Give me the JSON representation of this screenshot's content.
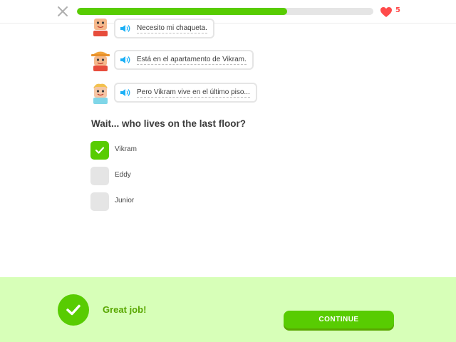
{
  "header": {
    "progress_fraction": 0.71,
    "hearts_count": "5",
    "close_icon": "close-x-icon",
    "heart_icon": "heart-icon"
  },
  "dialog": [
    {
      "avatar": "character-avatar-1",
      "text": "Necesito mi chaqueta."
    },
    {
      "avatar": "character-avatar-2",
      "text": "Está en el apartamento de Vikram."
    },
    {
      "avatar": "character-avatar-3",
      "text": "Pero Vikram vive en el último piso..."
    }
  ],
  "question": "Wait... who lives on the last floor?",
  "options": [
    {
      "label": "Vikram",
      "checked": true
    },
    {
      "label": "Eddy",
      "checked": false
    },
    {
      "label": "Junior",
      "checked": false
    }
  ],
  "footer": {
    "feedback": "Great job!",
    "continue_label": "CONTINUE"
  },
  "colors": {
    "accent_green": "#58cc02",
    "dark_green": "#58a700",
    "footer_bg": "#d7ffb8",
    "heart_red": "#ff4b4b"
  }
}
